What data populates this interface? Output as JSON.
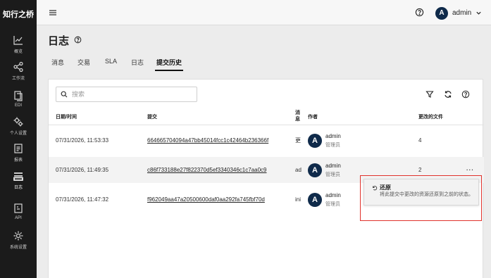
{
  "brand": "知行之桥",
  "sidebar": {
    "items": [
      {
        "label": "概览",
        "icon": "chart-line-icon"
      },
      {
        "label": "工作流",
        "icon": "share-nodes-icon"
      },
      {
        "label": "EDI",
        "icon": "document-copy-icon"
      },
      {
        "label": "个人设置",
        "icon": "gears-icon"
      },
      {
        "label": "报表",
        "icon": "report-icon"
      },
      {
        "label": "日志",
        "icon": "log-stack-icon",
        "active": true
      },
      {
        "label": "API",
        "icon": "api-icon"
      },
      {
        "label": "系统设置",
        "icon": "settings-gear-icon"
      }
    ]
  },
  "topbar": {
    "user_initial": "A",
    "username": "admin"
  },
  "page": {
    "title": "日志"
  },
  "tabs": [
    {
      "label": "消息"
    },
    {
      "label": "交易"
    },
    {
      "label": "SLA"
    },
    {
      "label": "日志"
    },
    {
      "label": "提交历史",
      "active": true
    }
  ],
  "search": {
    "placeholder": "搜索"
  },
  "table": {
    "headers": {
      "date": "日期/时间",
      "commit": "提交",
      "message": "消息",
      "author": "作者",
      "changed": "更改的文件"
    },
    "rows": [
      {
        "date": "07/31/2026, 11:53:33",
        "commit": "664665704094a47bb45014fcc1c42464b236366f",
        "message": "更",
        "author": "admin",
        "author_initial": "A",
        "role": "管理员",
        "changed": "4"
      },
      {
        "date": "07/31/2026, 11:49:35",
        "commit": "c86f733188e27f822370d5ef3340346c1c7aa0c9",
        "message": "ad",
        "author": "admin",
        "author_initial": "A",
        "role": "管理员",
        "changed": "2"
      },
      {
        "date": "07/31/2026, 11:47:32",
        "commit": "f962049aa47a20500600daf0aa292fa745fbf70d",
        "message": "ini",
        "author": "admin",
        "author_initial": "A",
        "role": "管理员",
        "changed": ""
      }
    ],
    "more_label": "···"
  },
  "popup": {
    "title": "还原",
    "description": "将此提交中更改的资源还原到之前的状态。"
  },
  "colors": {
    "sidebar_bg": "#1b1b1b",
    "avatar_bg": "#0f2a4a",
    "highlight_border": "#e0312b"
  }
}
